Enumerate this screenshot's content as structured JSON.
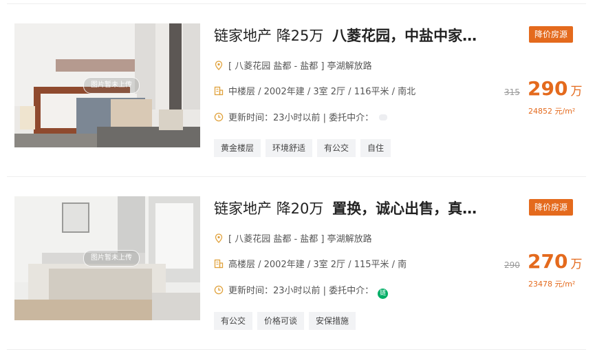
{
  "placeholder_text": "图片暂未上传",
  "listings": [
    {
      "agency": "链家地产",
      "drop": "降25万",
      "title": "八菱花园，中盐中家…",
      "badge": "降价房源",
      "address": "[ 八菱花园 盐都 - 盐都 ] 亭湖解放路",
      "info": "中楼层 / 2002年建 / 3室 2厅 / 116平米 / 南北",
      "time": "更新时间：23小时以前 | 委托中介：",
      "tags": [
        "黄金楼层",
        "环境舒适",
        "有公交",
        "自住"
      ],
      "old_price": "315",
      "price": "290",
      "price_unit": "万",
      "unit_price": "24852 元/m²"
    },
    {
      "agency": "链家地产",
      "drop": "降20万",
      "title": "置换，诚心出售，真…",
      "badge": "降价房源",
      "address": "[ 八菱花园 盐都 - 盐都 ] 亭湖解放路",
      "info": "高楼层 / 2002年建 / 3室 2厅 / 115平米 / 南",
      "time": "更新时间：23小时以前 | 委托中介：",
      "agent_badge": "链",
      "tags": [
        "有公交",
        "价格可谈",
        "安保措施"
      ],
      "old_price": "290",
      "price": "270",
      "price_unit": "万",
      "unit_price": "23478 元/m²"
    }
  ],
  "colors": {
    "accent": "#e46a1d",
    "agent_badge": "#00ae66",
    "tag_bg": "#f2f3f5"
  },
  "icons": {
    "address": "map-pin-icon",
    "info": "building-icon",
    "time": "clock-icon"
  }
}
